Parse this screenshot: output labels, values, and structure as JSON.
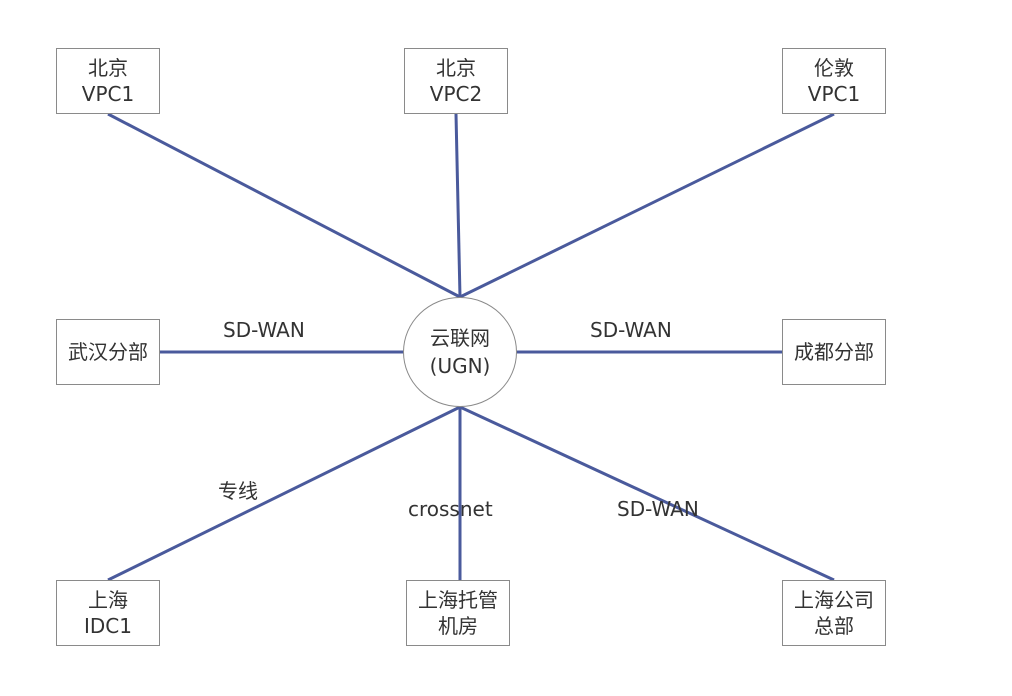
{
  "hub": {
    "line1": "云联网",
    "line2": "(UGN)"
  },
  "nodes": {
    "beijing_vpc1": {
      "line1": "北京",
      "line2": "VPC1"
    },
    "beijing_vpc2": {
      "line1": "北京",
      "line2": "VPC2"
    },
    "london_vpc1": {
      "line1": "伦敦",
      "line2": "VPC1"
    },
    "wuhan_branch": {
      "line1": "武汉分部"
    },
    "chengdu_branch": {
      "line1": "成都分部"
    },
    "shanghai_idc1": {
      "line1": "上海",
      "line2": "IDC1"
    },
    "shanghai_hosting": {
      "line1": "上海托管",
      "line2": "机房"
    },
    "shanghai_hq": {
      "line1": "上海公司",
      "line2": "总部"
    }
  },
  "edges": {
    "wuhan": "SD-WAN",
    "chengdu": "SD-WAN",
    "idc": "专线",
    "hosting": "crossnet",
    "hq": "SD-WAN"
  },
  "colors": {
    "line": "#4a5a9c",
    "border": "#8a8a8a",
    "text": "#333333"
  }
}
